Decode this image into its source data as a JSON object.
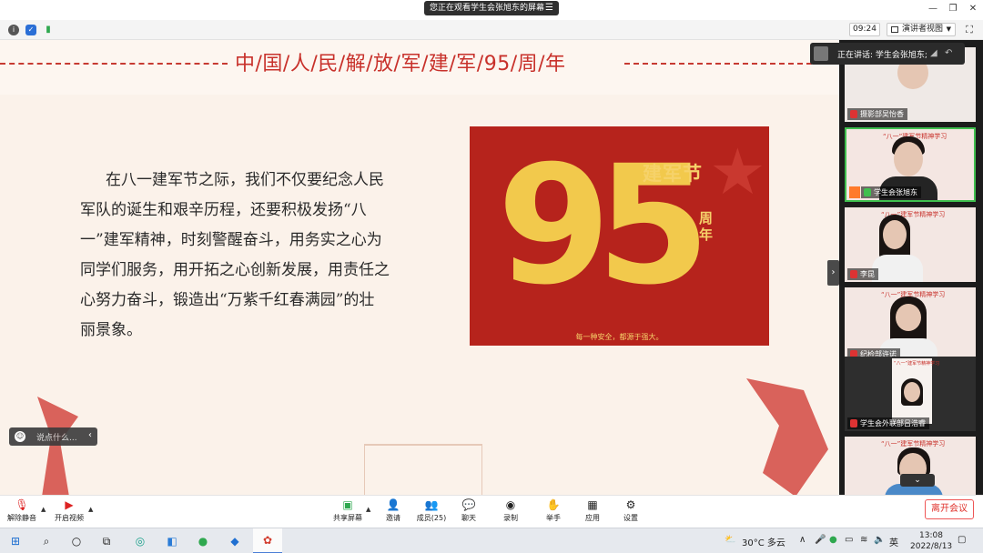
{
  "window": {
    "sharing_banner": "您正在观看学生会张旭东的屏幕",
    "meeting_time": "09:24",
    "view_button": "演讲者视图"
  },
  "slide": {
    "title": "中/国/人/民/解/放/军/建/军/95/周/年",
    "paragraph": "在八一建军节之际，我们不仅要纪念人民军队的诞生和艰辛历程，还要积极发扬“八一”建军精神，时刻警醒奋斗，用务实之心为同学们服务，用开拓之心创新发展，用责任之心努力奋斗，锻造出“万紫千红春满园”的壮丽景象。",
    "poster": {
      "number": "95",
      "headline": "建军节",
      "side": "周年",
      "slogan": "每一种安全，都源于强大。"
    },
    "chat_preview": "说点什么..."
  },
  "panel": {
    "speaking": "正在讲话: 学生会张旭东;",
    "tiles": [
      {
        "name": "摄影部吴怡香",
        "banner": ""
      },
      {
        "name": "学生会张旭东",
        "banner": "“八一”建军节精神学习"
      },
      {
        "name": "李昆",
        "banner": "“八一”建军节精神学习"
      },
      {
        "name": "纪检部许诺",
        "banner": "“八一”建军节精神学习"
      },
      {
        "name": "学生会外联部吕浩睿",
        "banner": "“八一”建军节精神学习"
      },
      {
        "name": "",
        "banner": "“八一”建军节精神学习"
      }
    ]
  },
  "controls": {
    "unmute": "解除静音",
    "start_video": "开启视频",
    "share_screen": "共享屏幕",
    "invite": "邀请",
    "members": "成员(25)",
    "chat": "聊天",
    "record": "录制",
    "raise_hand": "举手",
    "apps": "应用",
    "settings": "设置",
    "leave": "离开会议"
  },
  "taskbar": {
    "weather": "30°C 多云",
    "ime": "英",
    "time": "13:08",
    "date": "2022/8/13"
  },
  "colors": {
    "accent_red": "#c8312b",
    "poster_red": "#b6231c",
    "poster_gold": "#f2c94c",
    "active_speaker": "#3fbf4e"
  }
}
